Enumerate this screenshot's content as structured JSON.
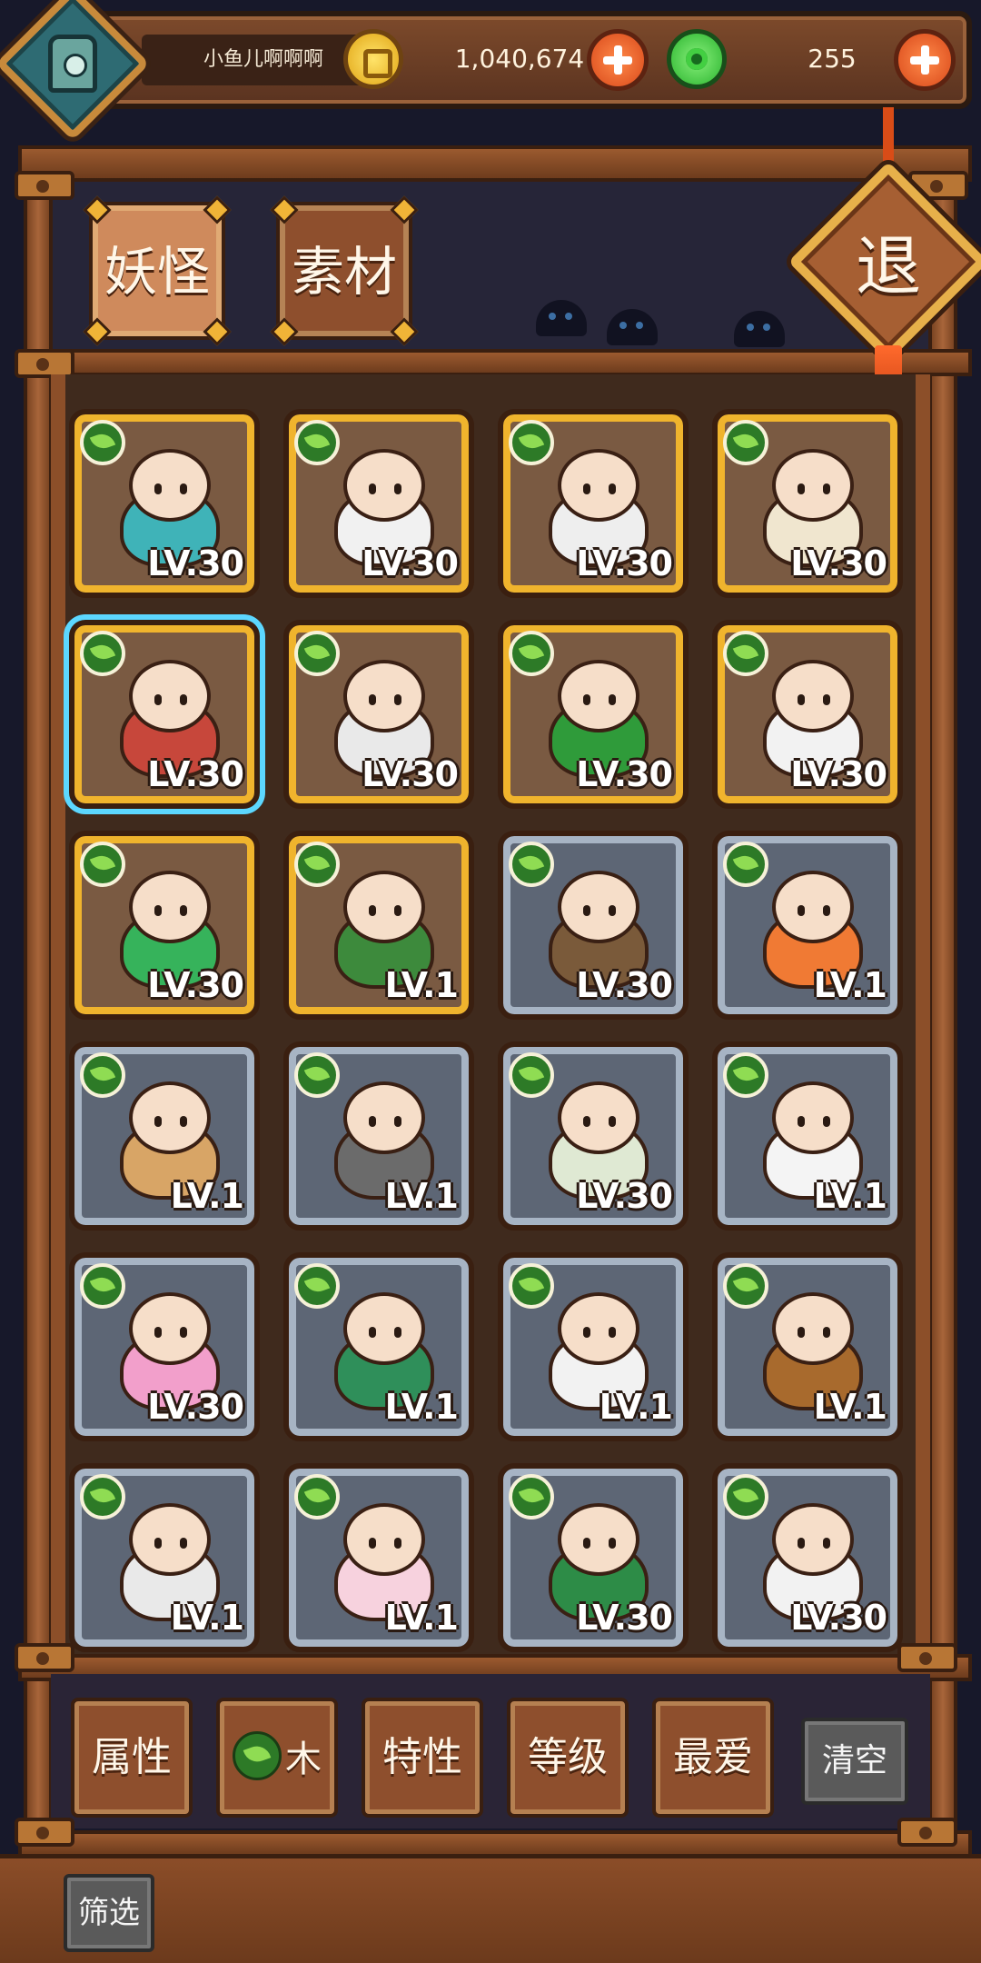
{
  "header": {
    "username": "小鱼儿啊啊啊",
    "gold_amount": "1,040,674",
    "jade_amount": "255",
    "avatar_icon": "lantern-avatar-icon",
    "gold_icon": "gold-coin-icon",
    "jade_icon": "jade-coin-icon"
  },
  "tabs": [
    {
      "label": "妖怪",
      "active": true
    },
    {
      "label": "素材",
      "active": false
    }
  ],
  "exit_label": "退",
  "cards": [
    {
      "level": "LV.30",
      "frame": "gold",
      "element": "wood",
      "creature": "blue-dragon"
    },
    {
      "level": "LV.30",
      "frame": "gold",
      "element": "wood",
      "creature": "white-sheep"
    },
    {
      "level": "LV.30",
      "frame": "gold",
      "element": "wood",
      "creature": "white-tiger"
    },
    {
      "level": "LV.30",
      "frame": "gold",
      "element": "wood",
      "creature": "leaf-girl"
    },
    {
      "level": "LV.30",
      "frame": "gold",
      "element": "wood",
      "creature": "coin-girl",
      "selected": true
    },
    {
      "level": "LV.30",
      "frame": "gold",
      "element": "wood",
      "creature": "flower-lady"
    },
    {
      "level": "LV.30",
      "frame": "gold",
      "element": "wood",
      "creature": "green-lion"
    },
    {
      "level": "LV.30",
      "frame": "gold",
      "element": "wood",
      "creature": "white-vase"
    },
    {
      "level": "LV.30",
      "frame": "gold",
      "element": "wood",
      "creature": "jade-gourd"
    },
    {
      "level": "LV.1",
      "frame": "gold",
      "element": "wood",
      "creature": "snake-hair-girl"
    },
    {
      "level": "LV.30",
      "frame": "silver",
      "element": "wood",
      "creature": "log-spirit"
    },
    {
      "level": "LV.1",
      "frame": "silver",
      "element": "wood",
      "creature": "teal-hair-boy"
    },
    {
      "level": "LV.1",
      "frame": "silver",
      "element": "wood",
      "creature": "wooden-doll"
    },
    {
      "level": "LV.1",
      "frame": "silver",
      "element": "wood",
      "creature": "grey-wolf"
    },
    {
      "level": "LV.30",
      "frame": "silver",
      "element": "wood",
      "creature": "twin-girls"
    },
    {
      "level": "LV.1",
      "frame": "silver",
      "element": "wood",
      "creature": "mahjong-tile"
    },
    {
      "level": "LV.30",
      "frame": "silver",
      "element": "wood",
      "creature": "pink-hair-vine"
    },
    {
      "level": "LV.1",
      "frame": "silver",
      "element": "wood",
      "creature": "hat-boy"
    },
    {
      "level": "LV.1",
      "frame": "silver",
      "element": "wood",
      "creature": "scroll-sprite"
    },
    {
      "level": "LV.1",
      "frame": "silver",
      "element": "wood",
      "creature": "chestnut-kid"
    },
    {
      "level": "LV.1",
      "frame": "silver",
      "element": "wood",
      "creature": "paper-lantern"
    },
    {
      "level": "LV.1",
      "frame": "silver",
      "element": "wood",
      "creature": "cherry-blossom"
    },
    {
      "level": "LV.30",
      "frame": "silver",
      "element": "wood",
      "creature": "green-serpent"
    },
    {
      "level": "LV.30",
      "frame": "silver",
      "element": "wood",
      "creature": "dice-tile"
    }
  ],
  "filters": [
    {
      "label": "属性"
    },
    {
      "label": "木",
      "icon": "wood-leaf-icon"
    },
    {
      "label": "特性"
    },
    {
      "label": "等级"
    },
    {
      "label": "最爱"
    }
  ],
  "clear_label": "清空",
  "screen_label": "筛选",
  "colors": {
    "wood": "#8c4f29",
    "gold_frame": "#f0b42d",
    "silver_frame": "#a7b4c4",
    "selection": "#5cd7ff",
    "leaf": "#8fdc53"
  }
}
